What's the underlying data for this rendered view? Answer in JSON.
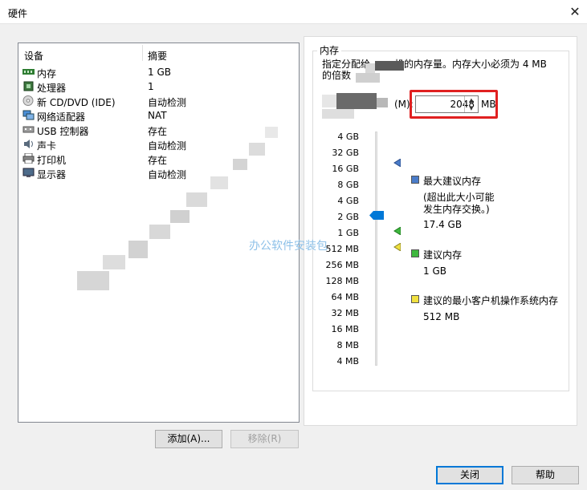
{
  "window": {
    "title": "硬件",
    "close_glyph": "✕"
  },
  "devices": {
    "col_device": "设备",
    "col_summary": "摘要",
    "items": [
      {
        "name": "内存",
        "summary": "1 GB",
        "icon": "memory-icon"
      },
      {
        "name": "处理器",
        "summary": "1",
        "icon": "cpu-icon"
      },
      {
        "name": "新 CD/DVD (IDE)",
        "summary": "自动检测",
        "icon": "cd-icon"
      },
      {
        "name": "网络适配器",
        "summary": "NAT",
        "icon": "network-icon"
      },
      {
        "name": "USB 控制器",
        "summary": "存在",
        "icon": "usb-icon"
      },
      {
        "name": "声卡",
        "summary": "自动检测",
        "icon": "sound-icon"
      },
      {
        "name": "打印机",
        "summary": "存在",
        "icon": "printer-icon"
      },
      {
        "name": "显示器",
        "summary": "自动检测",
        "icon": "display-icon"
      }
    ]
  },
  "buttons": {
    "add": "添加(A)...",
    "remove": "移除(R)",
    "close": "关闭",
    "help": "帮助"
  },
  "memory": {
    "group_title": "内存",
    "desc_line1": "指定分配给",
    "desc_line1b": "机的内存量。内存大小必须为 4 MB",
    "desc_line2": "的倍数",
    "label_tail": "(M):",
    "value": "2048",
    "unit": "MB",
    "scale": [
      "64 GB",
      "32 GB",
      "16 GB",
      "8 GB",
      "4 GB",
      "2 GB",
      "1 GB",
      "512 MB",
      "256 MB",
      "128 MB",
      "64 MB",
      "32 MB",
      "16 MB",
      "8 MB",
      "4 MB"
    ],
    "scale_first_partial": "4 GB",
    "legend": {
      "max_title": "最大建议内存",
      "max_note1": "(超出此大小可能",
      "max_note2": "发生内存交换。)",
      "max_value": "17.4 GB",
      "rec_title": "建议内存",
      "rec_value": "1 GB",
      "min_title": "建议的最小客户机操作系统内存",
      "min_value": "512 MB"
    }
  },
  "watermark": "办公软件安装包",
  "colors": {
    "max": "#4a7cc9",
    "rec": "#3fb83f",
    "min": "#f0e040",
    "accent": "#0078d7",
    "highlight": "#e02020"
  }
}
